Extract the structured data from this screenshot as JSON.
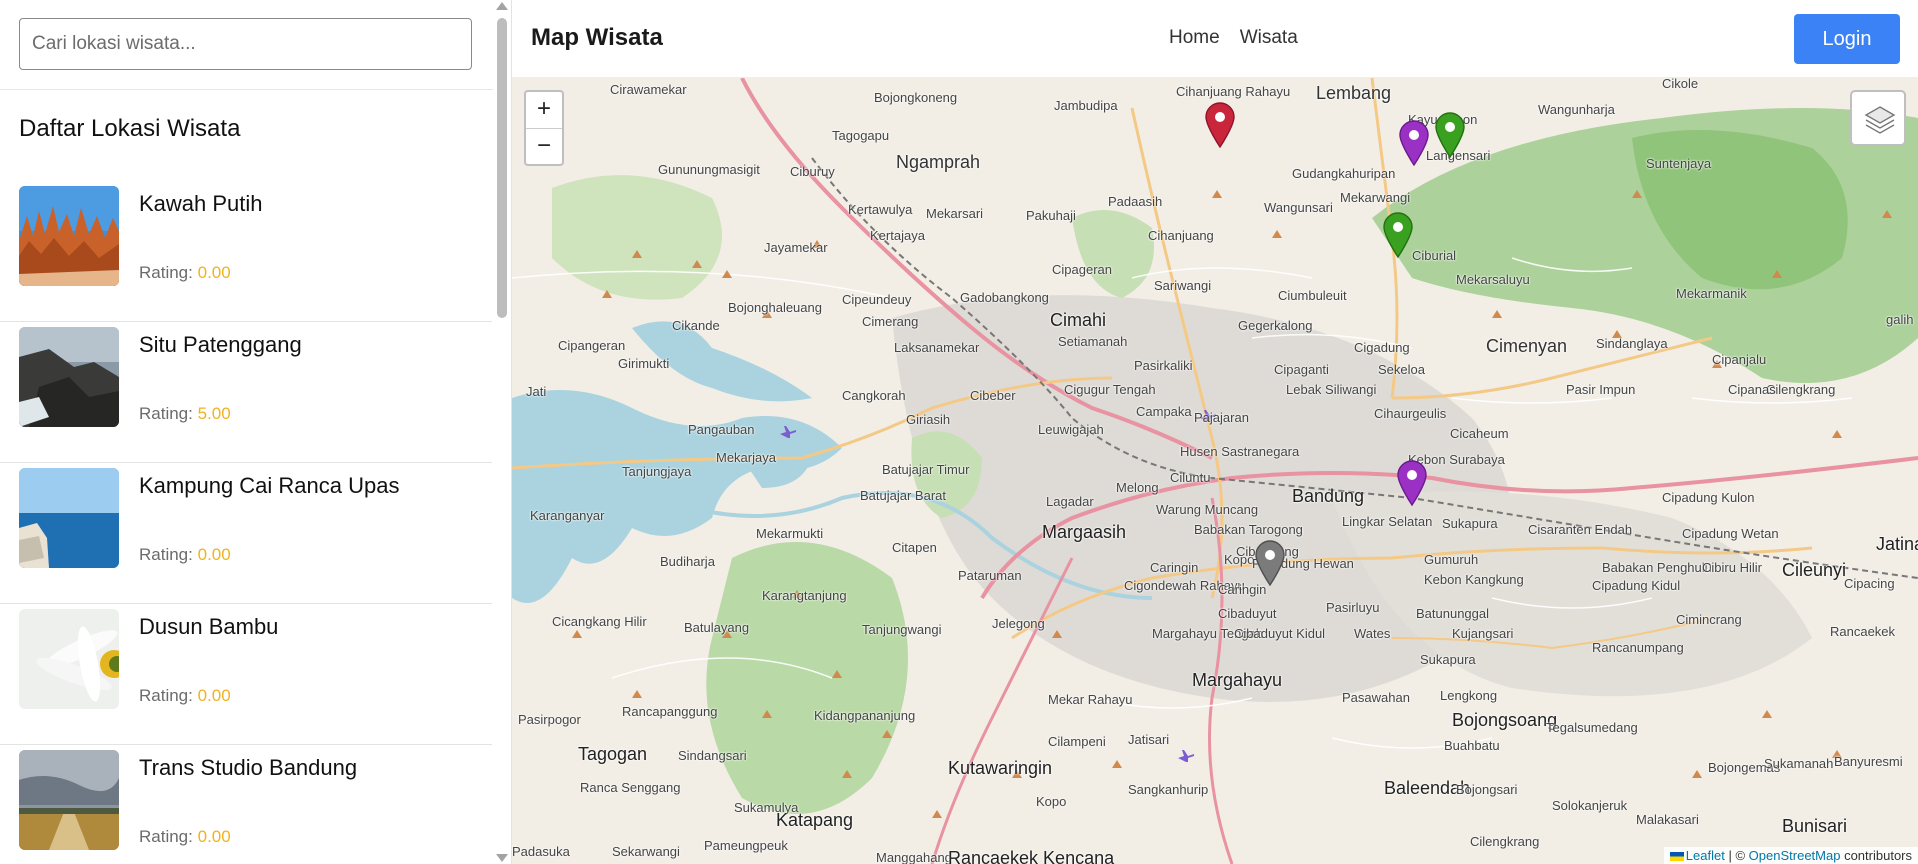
{
  "sidebar": {
    "search": {
      "placeholder": "Cari lokasi wisata..."
    },
    "list_title": "Daftar Lokasi Wisata",
    "rating_label": "Rating:",
    "items": [
      {
        "name": "Kawah Putih",
        "rating": "0.00",
        "thumb": "canyon-rocks"
      },
      {
        "name": "Situ Patenggang",
        "rating": "5.00",
        "thumb": "sea-cliffs"
      },
      {
        "name": "Kampung Cai Ranca Upas",
        "rating": "0.00",
        "thumb": "coast-sea"
      },
      {
        "name": "Dusun Bambu",
        "rating": "0.00",
        "thumb": "daisy-flower"
      },
      {
        "name": "Trans Studio Bandung",
        "rating": "0.00",
        "thumb": "field-road"
      }
    ]
  },
  "header": {
    "brand": "Map Wisata",
    "nav": [
      "Home",
      "Wisata"
    ],
    "login_label": "Login",
    "accent_color": "#3b82f6"
  },
  "map": {
    "zoom_in": "+",
    "zoom_out": "−",
    "attribution": {
      "leaflet": "Leaflet",
      "separator": "| ©",
      "osm": "OpenStreetMap",
      "suffix": "contributors"
    },
    "labels": [
      "Cirawamekar",
      "Bojongkoneng",
      "Jambudipa",
      "Cihanjuang Rahayu",
      "Lembang",
      "Kayuambon",
      "Wangunharja",
      "Cikole",
      "Tagogapu",
      "Ngamprah",
      "Gununungmasigit",
      "Ciburuy",
      "Gudangkahuripan",
      "Langensari",
      "Suntenjaya",
      "Padaasih",
      "Kertawulya",
      "Mekarsari",
      "Pakuhaji",
      "Wangunsari",
      "Mekarwangi",
      "Jayamekar",
      "Kertajaya",
      "Cihanjuang",
      "Ciburial",
      "Cipageran",
      "Sariwangi",
      "Mekarsaluyu",
      "Cipeundeuy",
      "Gadobangkong",
      "Cimahi",
      "Ciumbuleuit",
      "Bojonghaleuang",
      "Cikande",
      "Cimerang",
      "Setiamanah",
      "Gegerkalong",
      "Cimenyan",
      "Mekarmanik",
      "Laksanamekar",
      "Cigadung",
      "Sindanglaya",
      "Cipanjalu",
      "Cipangeran",
      "Girimukti",
      "Pasirkaliki",
      "Cipaganti",
      "Sekeloa",
      "Pasir Impun",
      "Cilengkrang",
      "Cangkorah",
      "Cibeber",
      "Cigugur Tengah",
      "Lebak Siliwangi",
      "Jati",
      "Giriasih",
      "Leuwigajah",
      "Campaka",
      "Pajajaran",
      "Cihaurgeulis",
      "Cicaheum",
      "Pangauban",
      "Mekarjaya",
      "Batujajar Timur",
      "Husen Sastranegara",
      "Kebon Surabaya",
      "Tanjungjaya",
      "Batujajar Barat",
      "Ciluntu",
      "Bandung",
      "Cipadung Kulon",
      "Lagadar",
      "Melong",
      "Warung Muncang",
      "Karanganyar",
      "Mekarmukti",
      "Margaasih",
      "Babakan Tarogong",
      "Lingkar Selatan",
      "Sukapura",
      "Cisaranten Endah",
      "Cipadung Wetan",
      "Jatinangor",
      "Citapen",
      "Caringin",
      "Kopo",
      "Cibolerang",
      "Gumuruh",
      "Budiharja",
      "Karangtanjung",
      "Pataruman",
      "Cigondewah Rahayu",
      "Caringin",
      "Pelindung Hewan",
      "Kebon Kangkung",
      "Babakan Penghulu",
      "Cibiru Hilir",
      "Cileunyi",
      "Cipacing",
      "Cicangkang Hilir",
      "Batulayang",
      "Tanjungwangi",
      "Jelegong",
      "Cibaduyut",
      "Pasirluyu",
      "Batununggal",
      "Cipadung Kidul",
      "Cimincrang",
      "Rancaekek",
      "Margahayu Tengah",
      "Cibaduyut Kidul",
      "Wates",
      "Kujangsari",
      "Rancanumpang",
      "Margahayu",
      "Sukapura",
      "Rancapanggung",
      "Kidangpananjung",
      "Mekar Rahayu",
      "Pasawahan",
      "Lengkong",
      "Bojongsoang",
      "Pasirpogor",
      "Cilampeni",
      "Jatisari",
      "Buahbatu",
      "Tegalsumedang",
      "Tagogan",
      "Sindangsari",
      "Kutawaringin",
      "Bojongemas",
      "Sukamanah",
      "Ranca Senggang",
      "Sangkanhurip",
      "Baleendah",
      "Bojongsari",
      "Sukamulya",
      "Kopo",
      "Katapang",
      "Malakasari",
      "Solokanjeruk",
      "Bunisari",
      "Padasuka",
      "Sekarwangi",
      "Pameungpeuk",
      "Manggahang",
      "Rancaekek Kencana",
      "Cilengkrang",
      "Banyuresmi",
      "Cipanas",
      "galih"
    ],
    "markers": [
      {
        "color": "#c9263b",
        "kind": "red"
      },
      {
        "color": "#9b31c4",
        "kind": "purple"
      },
      {
        "color": "#3aa020",
        "kind": "green"
      },
      {
        "color": "#3aa020",
        "kind": "green"
      },
      {
        "color": "#9b31c4",
        "kind": "purple"
      },
      {
        "color": "#7b7b7b",
        "kind": "gray"
      }
    ],
    "layers_control": "layers-icon"
  }
}
